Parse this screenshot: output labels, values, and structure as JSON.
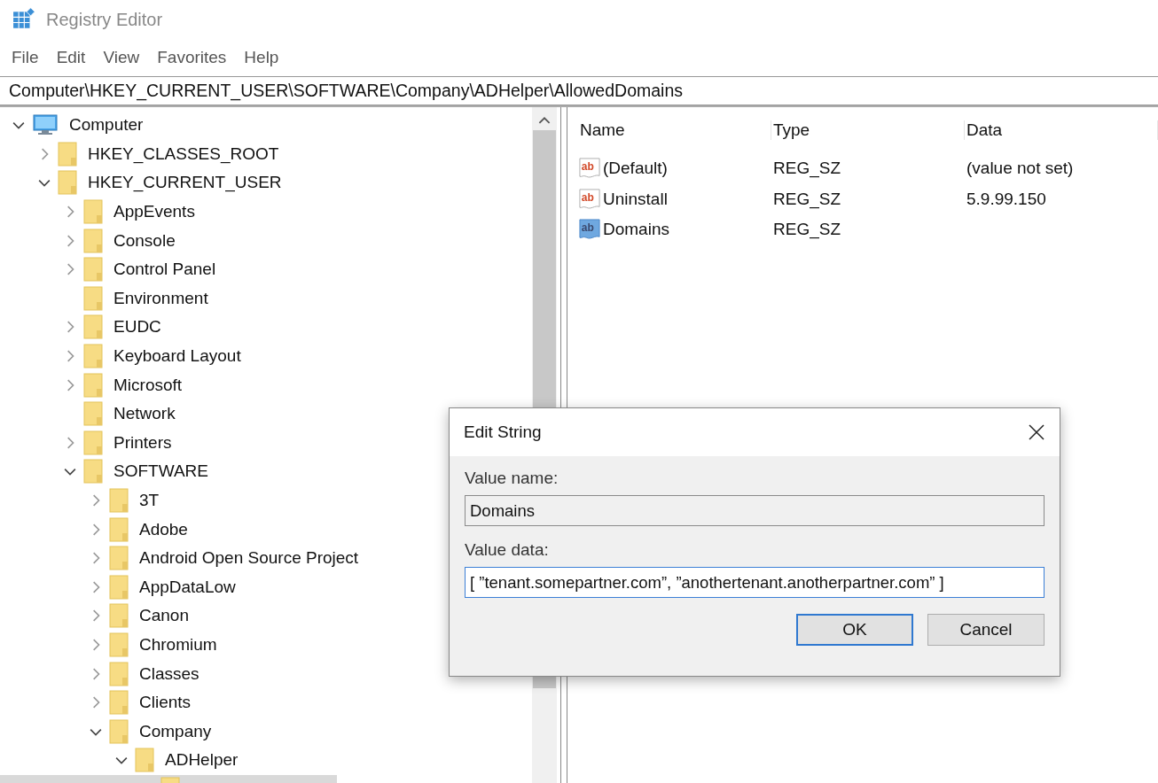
{
  "window": {
    "title": "Registry Editor"
  },
  "menu": [
    "File",
    "Edit",
    "View",
    "Favorites",
    "Help"
  ],
  "address_bar": {
    "value": "Computer\\HKEY_CURRENT_USER\\SOFTWARE\\Company\\ADHelper\\AllowedDomains"
  },
  "tree": [
    {
      "name": "Computer",
      "kind": "computer",
      "has_children": true,
      "expanded": true,
      "selected": false,
      "children": [
        {
          "name": "HKEY_CLASSES_ROOT",
          "kind": "folder",
          "has_children": true,
          "expanded": false,
          "selected": false
        },
        {
          "name": "HKEY_CURRENT_USER",
          "kind": "folder",
          "has_children": true,
          "expanded": true,
          "selected": false,
          "children": [
            {
              "name": "AppEvents",
              "kind": "folder",
              "has_children": true,
              "expanded": false,
              "selected": false
            },
            {
              "name": "Console",
              "kind": "folder",
              "has_children": true,
              "expanded": false,
              "selected": false
            },
            {
              "name": "Control Panel",
              "kind": "folder",
              "has_children": true,
              "expanded": false,
              "selected": false
            },
            {
              "name": "Environment",
              "kind": "folder",
              "has_children": false,
              "selected": false
            },
            {
              "name": "EUDC",
              "kind": "folder",
              "has_children": true,
              "expanded": false,
              "selected": false
            },
            {
              "name": "Keyboard Layout",
              "kind": "folder",
              "has_children": true,
              "expanded": false,
              "selected": false
            },
            {
              "name": "Microsoft",
              "kind": "folder",
              "has_children": true,
              "expanded": false,
              "selected": false
            },
            {
              "name": "Network",
              "kind": "folder",
              "has_children": false,
              "selected": false
            },
            {
              "name": "Printers",
              "kind": "folder",
              "has_children": true,
              "expanded": false,
              "selected": false
            },
            {
              "name": "SOFTWARE",
              "kind": "folder",
              "has_children": true,
              "expanded": true,
              "selected": false,
              "children": [
                {
                  "name": "3T",
                  "kind": "folder",
                  "has_children": true,
                  "expanded": false,
                  "selected": false
                },
                {
                  "name": "Adobe",
                  "kind": "folder",
                  "has_children": true,
                  "expanded": false,
                  "selected": false
                },
                {
                  "name": "Android Open Source Project",
                  "kind": "folder",
                  "has_children": true,
                  "expanded": false,
                  "selected": false
                },
                {
                  "name": "AppDataLow",
                  "kind": "folder",
                  "has_children": true,
                  "expanded": false,
                  "selected": false
                },
                {
                  "name": "Canon",
                  "kind": "folder",
                  "has_children": true,
                  "expanded": false,
                  "selected": false
                },
                {
                  "name": "Chromium",
                  "kind": "folder",
                  "has_children": true,
                  "expanded": false,
                  "selected": false
                },
                {
                  "name": "Classes",
                  "kind": "folder",
                  "has_children": true,
                  "expanded": false,
                  "selected": false
                },
                {
                  "name": "Clients",
                  "kind": "folder",
                  "has_children": true,
                  "expanded": false,
                  "selected": false
                },
                {
                  "name": "Company",
                  "kind": "folder",
                  "has_children": true,
                  "expanded": true,
                  "selected": false,
                  "children": [
                    {
                      "name": "ADHelper",
                      "kind": "folder",
                      "has_children": true,
                      "expanded": true,
                      "selected": false,
                      "children": [
                        {
                          "kind": "folder",
                          "has_children": false,
                          "selected": true
                        }
                      ]
                    }
                  ]
                }
              ]
            }
          ]
        }
      ]
    }
  ],
  "values": {
    "columns": [
      "Name",
      "Type",
      "Data"
    ],
    "rows": [
      {
        "icon_text": "ab",
        "name": "(Default)",
        "type": "REG_SZ",
        "data": "(value not set)",
        "selected": false
      },
      {
        "icon_text": "ab",
        "name": "Uninstall",
        "type": "REG_SZ",
        "data": "5.9.99.150",
        "selected": false
      },
      {
        "icon_text": "ab",
        "name": "Domains",
        "type": "REG_SZ",
        "selected": true
      }
    ]
  },
  "dialog": {
    "title": "Edit String",
    "value_name_label": "Value name:",
    "value_name": "Domains",
    "value_data_label": "Value data:",
    "value_data": "[ ”tenant.somepartner.com”, ”anothertenant.anotherpartner.com” ]",
    "buttons": [
      {
        "label": "OK",
        "default": true
      },
      {
        "label": "Cancel",
        "default": false
      }
    ]
  }
}
